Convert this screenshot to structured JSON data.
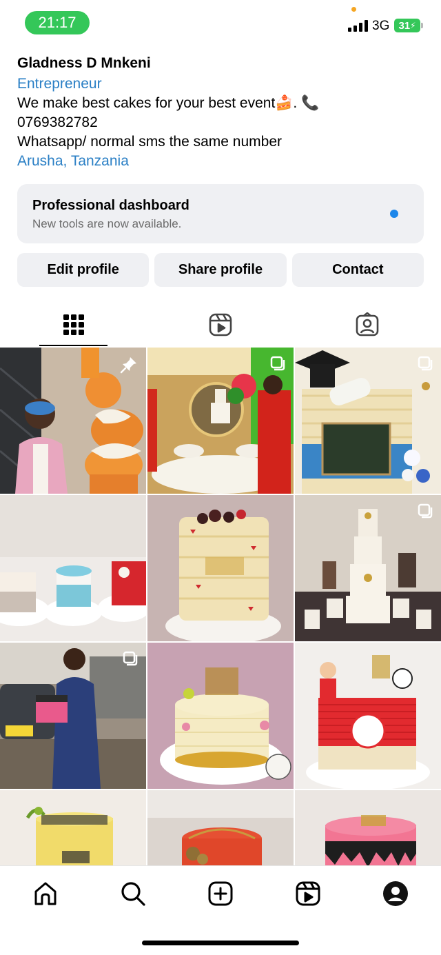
{
  "status_bar": {
    "time": "21:17",
    "network": "3G",
    "battery": "31"
  },
  "profile": {
    "name": "Gladness D Mnkeni",
    "category": "Entrepreneur",
    "bio_line1": "We make best cakes for your best event🍰. 📞",
    "bio_line2": "0769382782",
    "bio_line3": "Whatsapp/ normal sms the same number",
    "location": "Arusha, Tanzania"
  },
  "dashboard": {
    "title": "Professional dashboard",
    "subtitle": "New tools are now available."
  },
  "actions": {
    "edit": "Edit profile",
    "share": "Share profile",
    "contact": "Contact"
  },
  "tabs": [
    {
      "icon": "grid-icon",
      "active": true
    },
    {
      "icon": "reels-icon",
      "active": false
    },
    {
      "icon": "tagged-icon",
      "active": false
    }
  ],
  "posts": [
    {
      "name": "post-woman-with-tiered-cake",
      "badge": "pin-icon",
      "colors": [
        "#3b3b3b",
        "#e98d2b",
        "#f4efe6"
      ]
    },
    {
      "name": "post-wedding-cake-display",
      "badge": "multi-icon",
      "colors": [
        "#d9a04d",
        "#f5f1e4",
        "#d6281e"
      ]
    },
    {
      "name": "post-graduation-cake",
      "badge": "multi-icon",
      "colors": [
        "#f1e6c9",
        "#3a7bbf",
        "#2d2d2d"
      ]
    },
    {
      "name": "post-three-small-cakes",
      "badge": "",
      "colors": [
        "#f2efec",
        "#78c6d7",
        "#d3262d"
      ]
    },
    {
      "name": "post-happy-birthday-sheila-cake",
      "badge": "",
      "colors": [
        "#cbb8b4",
        "#f0e2b5",
        "#c3251f"
      ]
    },
    {
      "name": "post-tiered-wedding-cake-table",
      "badge": "multi-icon",
      "colors": [
        "#f2ede4",
        "#c9a13b",
        "#4d3c3c"
      ]
    },
    {
      "name": "post-man-holding-cake",
      "badge": "multi-icon",
      "colors": [
        "#6f737a",
        "#2b3f7a",
        "#e5508a"
      ]
    },
    {
      "name": "post-kendrah-birthday-cake",
      "badge": "",
      "colors": [
        "#c7a3b1",
        "#f6edd0",
        "#d8a630"
      ]
    },
    {
      "name": "post-simba-junior-cake",
      "badge": "",
      "colors": [
        "#f3f1ef",
        "#e22a2f",
        "#f0e4c4"
      ]
    },
    {
      "name": "post-yellow-cake-partial",
      "badge": "",
      "colors": [
        "#f4efe8",
        "#f0d764",
        "#3a3a3a"
      ]
    },
    {
      "name": "post-red-cake-partial",
      "badge": "",
      "colors": [
        "#d7cfc8",
        "#e0472a",
        "#a78542"
      ]
    },
    {
      "name": "post-pink-drip-cake-partial",
      "badge": "",
      "colors": [
        "#e9e4e0",
        "#f27593",
        "#222222"
      ]
    }
  ],
  "bottom_nav": [
    "home-icon",
    "search-icon",
    "create-icon",
    "reels-icon",
    "profile-icon"
  ]
}
